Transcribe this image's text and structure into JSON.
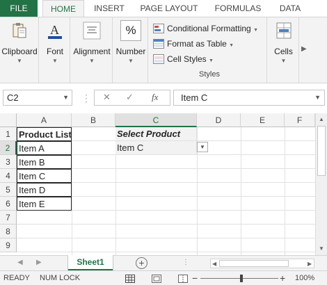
{
  "ribbon_tabs": {
    "file": "FILE",
    "home": "HOME",
    "insert": "INSERT",
    "page_layout": "PAGE LAYOUT",
    "formulas": "FORMULAS",
    "data": "DATA"
  },
  "ribbon": {
    "clipboard": "Clipboard",
    "font": "Font",
    "alignment": "Alignment",
    "number": "Number",
    "number_icon": "%",
    "conditional_formatting": "Conditional Formatting",
    "format_as_table": "Format as Table",
    "cell_styles": "Cell Styles",
    "styles_group": "Styles",
    "cells": "Cells"
  },
  "formula_bar": {
    "name_box": "C2",
    "cancel": "✕",
    "enter": "✓",
    "fx": "fx",
    "content": "Item C"
  },
  "columns": [
    "A",
    "B",
    "C",
    "D",
    "E",
    "F"
  ],
  "rows": [
    "1",
    "2",
    "3",
    "4",
    "5",
    "6",
    "7",
    "8",
    "9"
  ],
  "cells": {
    "A1": "Product List",
    "A2": "Item A",
    "A3": "Item B",
    "A4": "Item C",
    "A5": "Item D",
    "A6": "Item E",
    "C1": "Select Product",
    "C2": "Item C"
  },
  "sheets": {
    "active": "Sheet1",
    "add": "+"
  },
  "status": {
    "ready": "READY",
    "num_lock": "NUM LOCK",
    "zoom_minus": "−",
    "zoom_plus": "+",
    "zoom": "100%",
    "zoom_level": 1.0
  },
  "colors": {
    "accent": "#217346",
    "ribbon_bg": "#f3f3f3"
  }
}
